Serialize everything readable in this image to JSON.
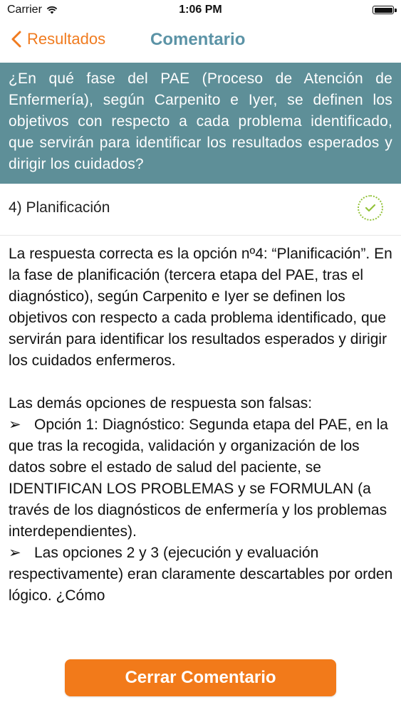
{
  "status_bar": {
    "carrier": "Carrier",
    "time": "1:06 PM",
    "wifi_icon": "wifi-icon",
    "battery_icon": "battery-icon"
  },
  "nav": {
    "back_label": "Resultados",
    "title": "Comentario",
    "accent_color": "#f07b1f",
    "title_color": "#5b93a6"
  },
  "question": {
    "text": "¿En qué fase del PAE (Proceso de Atención de Enfermería), según Carpenito e Iyer, se definen los objetivos con respecto a cada problema identificado, que servirán para identificar los resultados esperados y dirigir los cuidados?",
    "background_color": "#5e8f98"
  },
  "answer": {
    "text": "4)  Planificación",
    "status_icon": "check-circle-icon",
    "status_color": "#93c23a"
  },
  "comment": {
    "paragraph1": "La respuesta correcta es la opción nº4: “Planificación”. En la fase de planificación (tercera etapa del PAE, tras el diagnóstico), según Carpenito e Iyer se definen los objetivos con respecto a cada problema identificado, que servirán para identificar los resultados esperados y dirigir los cuidados enfermeros.",
    "paragraph2": "Las demás opciones de respuesta son falsas:",
    "bullet_symbol": "➢",
    "bullets": [
      "Opción 1: Diagnóstico: Segunda etapa del PAE, en la que tras la recogida, validación y organización de los datos sobre el estado de salud del paciente, se IDENTIFICAN LOS PROBLEMAS y se FORMULAN (a través de los diagnósticos de enfermería y los problemas interdependientes).",
      "Las opciones 2 y 3 (ejecución y evaluación respectivamente) eran claramente descartables por orden lógico. ¿Cómo"
    ]
  },
  "footer": {
    "close_label": "Cerrar Comentario",
    "button_color": "#f27a1a"
  }
}
